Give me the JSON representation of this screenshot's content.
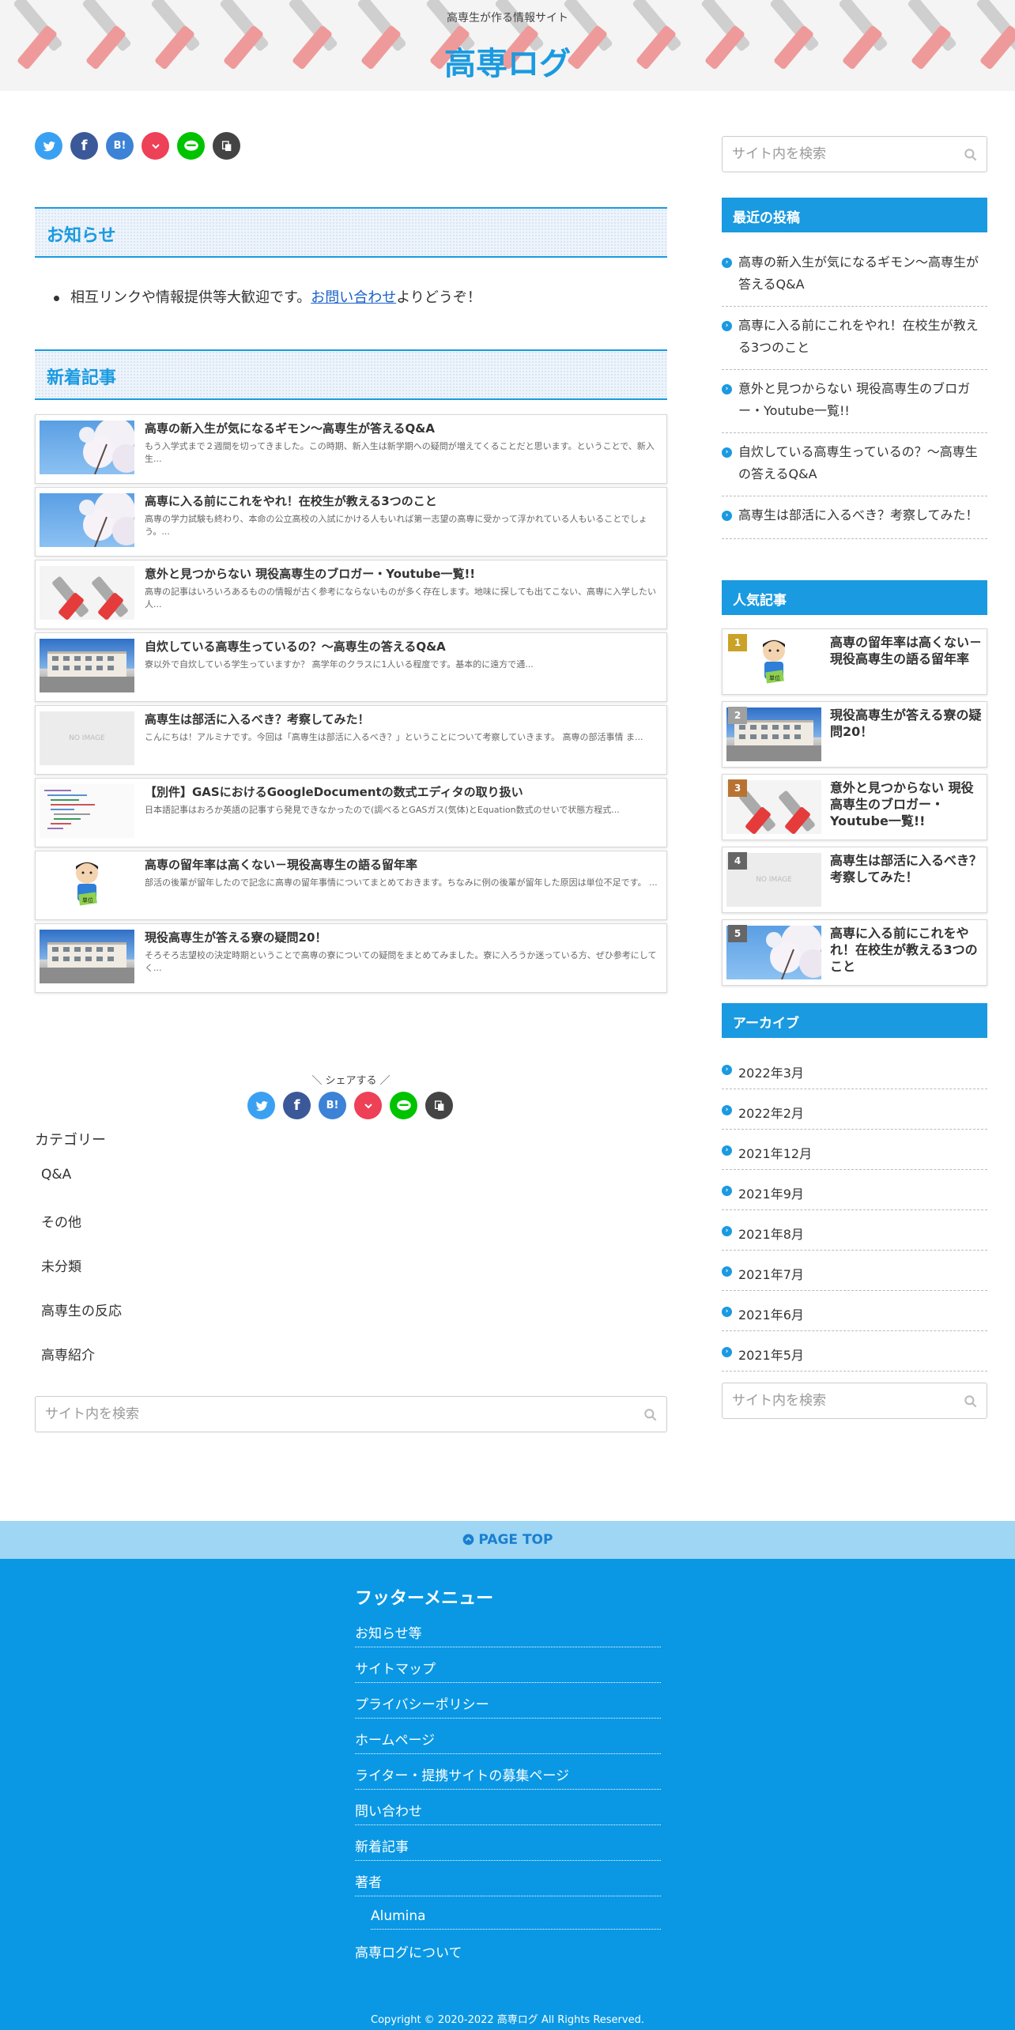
{
  "header": {
    "tagline": "高専生が作る情報サイト",
    "title": "高専ログ"
  },
  "share": {
    "twitter": "",
    "facebook": "f",
    "hatena": "B!",
    "pocket": "",
    "line": "",
    "copy": "",
    "bottom_label": "＼ シェアする ／"
  },
  "notice": {
    "heading": "お知らせ",
    "text_before": "相互リンクや情報提供等大歓迎です。",
    "link": "お問い合わせ",
    "text_after": "よりどうぞ！"
  },
  "new_articles": {
    "heading": "新着記事",
    "items": [
      {
        "title": "高専の新入生が気になるギモン～高専生が答えるQ&A",
        "excerpt": "もう入学式まで２週間を切ってきました。この時期、新入生は新学期への疑問が増えてくることだと思います。ということで、新入生...",
        "thumb": "sakura"
      },
      {
        "title": "高専に入る前にこれをやれ！在校生が教える3つのこと",
        "excerpt": "高専の学力試験も終わり、本命の公立高校の入試にかける人もいれば第一志望の高専に受かって浮かれている人もいることでしょう。...",
        "thumb": "sakura"
      },
      {
        "title": "意外と見つからない 現役高専生のブロガー・Youtube一覧!!",
        "excerpt": "高専の記事はいろいろあるものの情報が古く参考にならないものが多く存在します。地味に探しても出てこない、高専に入学したい人...",
        "thumb": "tools"
      },
      {
        "title": "自炊している高専生っているの？～高専生の答えるQ&A",
        "excerpt": "寮以外で自炊している学生っていますか？ 高学年のクラスに1人いる程度です。基本的に遠方で通...",
        "thumb": "building"
      },
      {
        "title": "高専生は部活に入るべき？考察してみた！",
        "excerpt": "こんにちは！アルミナです。今回は「高専生は部活に入るべき？」ということについて考察していきます。 高専の部活事情 ま...",
        "thumb": "noimage"
      },
      {
        "title": "【別件】GASにおけるGoogleDocumentの数式エディタの取り扱い",
        "excerpt": "日本語記事はおろか英語の記事すら発見できなかったので(調べるとGASガス(気体)とEquation数式のせいで状態方程式...",
        "thumb": "code"
      },
      {
        "title": "高専の留年率は高くない－現役高専生の語る留年率",
        "excerpt": "部活の後輩が留年したので記念に高専の留年事情についてまとめておきます。ちなみに例の後輩が留年した原因は単位不足です。 ...",
        "thumb": "person"
      },
      {
        "title": "現役高専生が答える寮の疑問20！",
        "excerpt": "そろそろ志望校の決定時期ということで高専の寮についての疑問をまとめてみました。寮に入ろうか迷っている方、ぜひ参考にしてく...",
        "thumb": "building"
      }
    ]
  },
  "noimage_label": "NO IMAGE",
  "categories": {
    "heading": "カテゴリー",
    "items": [
      "Q&A",
      "その他",
      "未分類",
      "高専生の反応",
      "高専紹介"
    ]
  },
  "search": {
    "placeholder": "サイト内を検索"
  },
  "sidebar": {
    "recent_heading": "最近の投稿",
    "recent": [
      "高専の新入生が気になるギモン～高専生が答えるQ&A",
      "高専に入る前にこれをやれ！在校生が教える3つのこと",
      "意外と見つからない 現役高専生のブロガー・Youtube一覧!!",
      "自炊している高専生っているの？～高専生の答えるQ&A",
      "高専生は部活に入るべき？考察してみた！"
    ],
    "popular_heading": "人気記事",
    "popular": [
      {
        "rank": "1",
        "title": "高専の留年率は高くない－現役高専生の語る留年率",
        "thumb": "person",
        "color": "#c9a227"
      },
      {
        "rank": "2",
        "title": "現役高専生が答える寮の疑問20！",
        "thumb": "building",
        "color": "#a0a0a0"
      },
      {
        "rank": "3",
        "title": "意外と見つからない 現役高専生のブロガー・Youtube一覧!!",
        "thumb": "tools",
        "color": "#b87333"
      },
      {
        "rank": "4",
        "title": "高専生は部活に入るべき？考察してみた！",
        "thumb": "noimage",
        "color": "#666666"
      },
      {
        "rank": "5",
        "title": "高専に入る前にこれをやれ！在校生が教える3つのこと",
        "thumb": "sakura",
        "color": "#666666"
      }
    ],
    "archive_heading": "アーカイブ",
    "archives": [
      "2022年3月",
      "2022年2月",
      "2021年12月",
      "2021年9月",
      "2021年8月",
      "2021年7月",
      "2021年6月",
      "2021年5月"
    ]
  },
  "pagetop": "PAGE TOP",
  "footer": {
    "heading": "フッターメニュー",
    "items": [
      "お知らせ等",
      "サイトマップ",
      "プライバシーポリシー",
      "ホームページ",
      "ライター・提携サイトの募集ページ",
      "問い合わせ",
      "新着記事",
      "著者"
    ],
    "sub_item": "Alumina",
    "last_item": "高専ログについて",
    "copyright": "Copyright © 2020-2022 高専ログ All Rights Reserved."
  },
  "colors": {
    "accent": "#1a9ae0",
    "footer_bg": "#0a98e4",
    "pagetop_bg": "#9ed6f4"
  }
}
